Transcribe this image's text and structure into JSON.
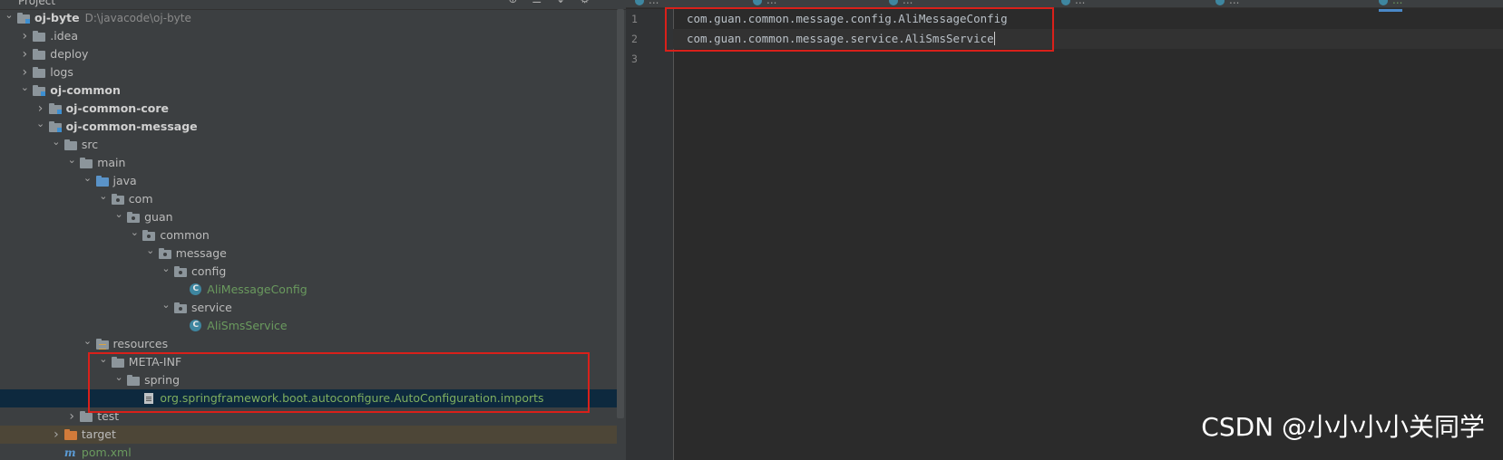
{
  "project_panel": {
    "title": "Project",
    "header_icons": [
      "crosshair-icon",
      "collapse-all-icon",
      "sort-icon",
      "gear-icon"
    ]
  },
  "tree": [
    {
      "label": "oj-byte",
      "path": "D:\\javacode\\oj-byte",
      "depth": 0,
      "arrow": "expanded",
      "icon": "module-folder",
      "style": "bold"
    },
    {
      "label": ".idea",
      "depth": 1,
      "arrow": "collapsed",
      "icon": "folder"
    },
    {
      "label": "deploy",
      "depth": 1,
      "arrow": "collapsed",
      "icon": "folder"
    },
    {
      "label": "logs",
      "depth": 1,
      "arrow": "collapsed",
      "icon": "folder"
    },
    {
      "label": "oj-common",
      "depth": 1,
      "arrow": "expanded",
      "icon": "module-folder",
      "style": "bold"
    },
    {
      "label": "oj-common-core",
      "depth": 2,
      "arrow": "collapsed",
      "icon": "module-folder",
      "style": "bold"
    },
    {
      "label": "oj-common-message",
      "depth": 2,
      "arrow": "expanded",
      "icon": "module-folder",
      "style": "bold"
    },
    {
      "label": "src",
      "depth": 3,
      "arrow": "expanded",
      "icon": "folder"
    },
    {
      "label": "main",
      "depth": 4,
      "arrow": "expanded",
      "icon": "folder"
    },
    {
      "label": "java",
      "depth": 5,
      "arrow": "expanded",
      "icon": "source-folder"
    },
    {
      "label": "com",
      "depth": 6,
      "arrow": "expanded",
      "icon": "package"
    },
    {
      "label": "guan",
      "depth": 7,
      "arrow": "expanded",
      "icon": "package"
    },
    {
      "label": "common",
      "depth": 8,
      "arrow": "expanded",
      "icon": "package"
    },
    {
      "label": "message",
      "depth": 9,
      "arrow": "expanded",
      "icon": "package"
    },
    {
      "label": "config",
      "depth": 10,
      "arrow": "expanded",
      "icon": "package"
    },
    {
      "label": "AliMessageConfig",
      "depth": 11,
      "arrow": "none",
      "icon": "class",
      "style": "green"
    },
    {
      "label": "service",
      "depth": 10,
      "arrow": "expanded",
      "icon": "package"
    },
    {
      "label": "AliSmsService",
      "depth": 11,
      "arrow": "none",
      "icon": "class",
      "style": "green"
    },
    {
      "label": "resources",
      "depth": 5,
      "arrow": "expanded",
      "icon": "resources-folder"
    },
    {
      "label": "META-INF",
      "depth": 6,
      "arrow": "expanded",
      "icon": "folder"
    },
    {
      "label": "spring",
      "depth": 7,
      "arrow": "expanded",
      "icon": "folder"
    },
    {
      "label": "org.springframework.boot.autoconfigure.AutoConfiguration.imports",
      "depth": 8,
      "arrow": "none",
      "icon": "file",
      "style": "lightgreen",
      "selected": true
    },
    {
      "label": "test",
      "depth": 4,
      "arrow": "collapsed",
      "icon": "folder"
    },
    {
      "label": "target",
      "depth": 3,
      "arrow": "collapsed",
      "icon": "excluded-folder",
      "excluded": true
    },
    {
      "label": "pom.xml",
      "depth": 3,
      "arrow": "none",
      "icon": "maven",
      "style": "green"
    }
  ],
  "editor": {
    "tabs": [
      {
        "label": "..."
      },
      {
        "label": "..."
      },
      {
        "label": "..."
      },
      {
        "label": "..."
      },
      {
        "label": "..."
      },
      {
        "label": "...",
        "active": true
      }
    ],
    "lines": [
      {
        "number": "1",
        "text": "com.guan.common.message.config.AliMessageConfig"
      },
      {
        "number": "2",
        "text": "com.guan.common.message.service.AliSmsService",
        "current": true
      },
      {
        "number": "3",
        "text": ""
      }
    ]
  },
  "watermark": "CSDN @小小小小关同学",
  "colors": {
    "panel_bg": "#3c3f41",
    "editor_bg": "#2b2b2b",
    "selection": "#0d293e",
    "excluded": "#4d4637",
    "highlight_box": "#d9201a"
  }
}
